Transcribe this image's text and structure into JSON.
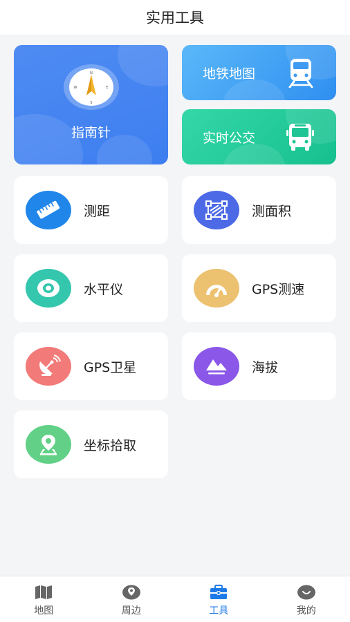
{
  "header": {
    "title": "实用工具"
  },
  "compass": {
    "label": "指南针",
    "dirs": [
      "N",
      "E",
      "S",
      "W"
    ]
  },
  "banners": {
    "subway": {
      "label": "地铁地图"
    },
    "bus": {
      "label": "实时公交"
    }
  },
  "tools": [
    {
      "label": "测距",
      "color": "#2186ea"
    },
    {
      "label": "测面积",
      "color": "#4d6ae6"
    },
    {
      "label": "水平仪",
      "color": "#34c7ad"
    },
    {
      "label": "GPS测速",
      "color": "#ecc170"
    },
    {
      "label": "GPS卫星",
      "color": "#f27a78"
    },
    {
      "label": "海拔",
      "color": "#8a57e8"
    },
    {
      "label": "坐标拾取",
      "color": "#62d187"
    }
  ],
  "tabbar": {
    "active": "工具",
    "items": [
      {
        "label": "地图"
      },
      {
        "label": "周边"
      },
      {
        "label": "工具"
      },
      {
        "label": "我的"
      }
    ]
  }
}
